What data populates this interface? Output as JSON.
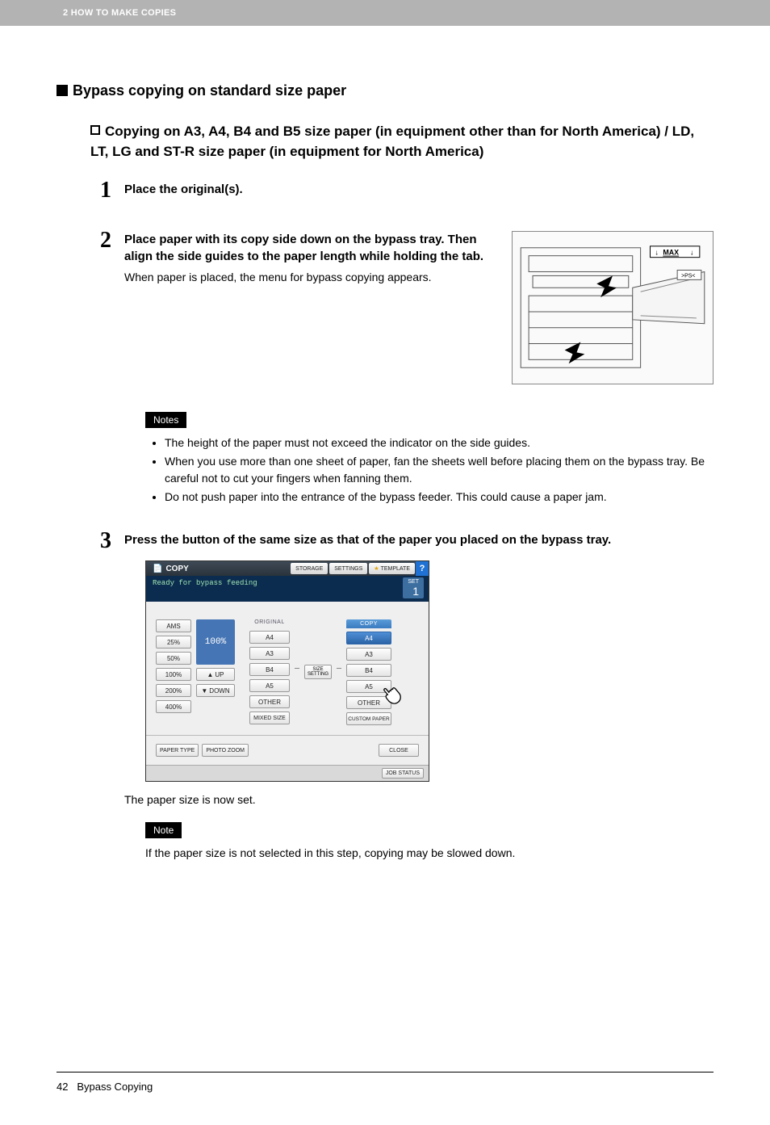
{
  "header": {
    "chapter": "2 HOW TO MAKE COPIES"
  },
  "section": {
    "title": "Bypass copying on standard size paper"
  },
  "subsection": {
    "title": "Copying on A3, A4, B4 and B5 size paper (in equipment other than for North America) / LD, LT, LG and ST-R size paper (in equipment for North America)"
  },
  "steps": {
    "s1": {
      "num": "1",
      "bold": "Place the original(s)."
    },
    "s2": {
      "num": "2",
      "bold": "Place paper with its copy side down on the bypass tray. Then align the side guides to the paper length while holding the tab.",
      "desc": "When paper is placed, the menu for bypass copying appears."
    },
    "s3": {
      "num": "3",
      "bold": "Press the button of the same size as that of the paper you placed on the bypass tray."
    }
  },
  "figure": {
    "max_label": "MAX",
    "ps_label": ">PS<"
  },
  "notes": {
    "label": "Notes",
    "items": [
      "The height of the paper must not exceed the indicator on the side guides.",
      "When you use more than one sheet of paper, fan the sheets well before placing them on the bypass tray. Be careful not to cut your fingers when fanning them.",
      "Do not push paper into the entrance of the bypass feeder. This could cause a paper jam."
    ]
  },
  "ui": {
    "title": "COPY",
    "tabs": {
      "storage": "STORAGE",
      "settings": "SETTINGS",
      "template": "TEMPLATE"
    },
    "help": "?",
    "status": "Ready for bypass feeding",
    "sets_label": "SET",
    "sets_value": "1",
    "zoom_buttons": [
      "AMS",
      "25%",
      "50%",
      "100%",
      "200%",
      "400%"
    ],
    "zoom_value": "100%",
    "updown": {
      "up": "UP",
      "down": "DOWN"
    },
    "original": {
      "header": "ORIGINAL",
      "items": [
        "A4",
        "A3",
        "B4",
        "A5",
        "OTHER",
        "MIXED SIZE"
      ]
    },
    "sizesetting": {
      "l1": "SIZE",
      "l2": "SETTING"
    },
    "copy": {
      "header": "COPY",
      "items": [
        "A4",
        "A3",
        "B4",
        "A5",
        "OTHER",
        "CUSTOM PAPER"
      ],
      "selected": 0
    },
    "footer": {
      "paper_type": "PAPER TYPE",
      "photo_zoom": "PHOTO ZOOM",
      "close": "CLOSE",
      "job_status": "JOB STATUS"
    }
  },
  "after_panel": "The paper size is now set.",
  "note2": {
    "label": "Note",
    "text": "If the paper size is not selected in this step, copying may be slowed down."
  },
  "footer": {
    "page": "42",
    "title": "Bypass Copying"
  }
}
